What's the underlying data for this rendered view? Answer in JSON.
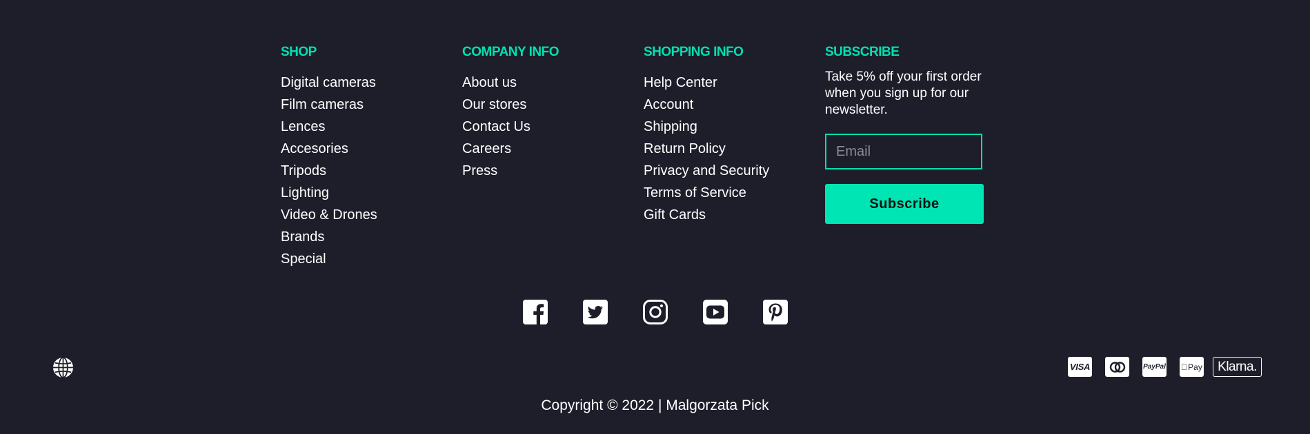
{
  "footer": {
    "columns": [
      {
        "title": "SHOP",
        "items": [
          "Digital cameras",
          "Film cameras",
          "Lences",
          "Accesories",
          "Tripods",
          "Lighting",
          "Video & Drones",
          "Brands",
          "Special"
        ]
      },
      {
        "title": "COMPANY INFO",
        "items": [
          "About us",
          "Our stores",
          "Contact Us",
          "Careers",
          "Press"
        ]
      },
      {
        "title": "SHOPPING INFO",
        "items": [
          "Help Center",
          "Account",
          "Shipping",
          "Return Policy",
          "Privacy and Security",
          "Terms of Service",
          "Gift Cards"
        ]
      }
    ],
    "subscribe": {
      "title": "SUBSCRIBE",
      "text": "Take 5% off your first order when you sign up for our newsletter.",
      "email_placeholder": "Email",
      "button_label": "Subscribe"
    },
    "social_icons": [
      "facebook-icon",
      "twitter-icon",
      "instagram-icon",
      "youtube-icon",
      "pinterest-icon"
    ],
    "language_icon": "globe-icon",
    "payments": {
      "visa": "VISA",
      "mastercard": "mastercard-icon",
      "paypal": "PayPal",
      "applepay": "Pay",
      "klarna": "Klarna."
    },
    "copyright": "Copyright © 2022 | Malgorzata Pick"
  },
  "colors": {
    "background": "#1e1e2b",
    "accent": "#00e5b4",
    "text": "#ffffff"
  }
}
